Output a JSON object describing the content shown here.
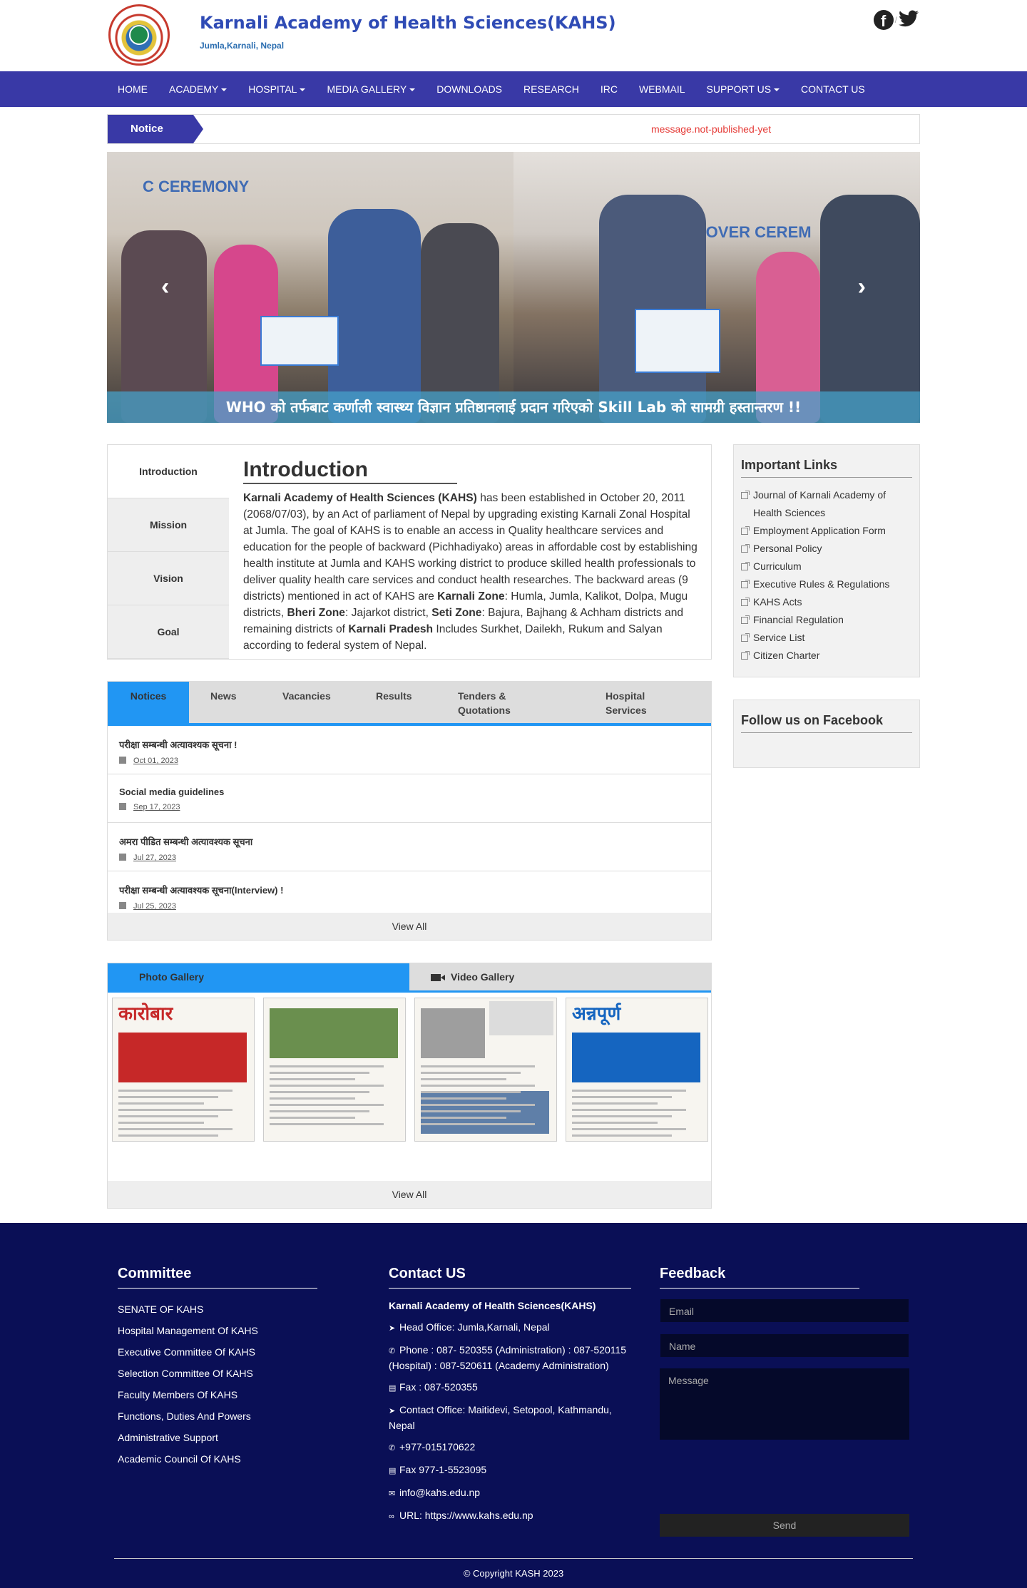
{
  "header": {
    "title": "Karnali Academy of Health Sciences(KAHS)",
    "subtitle": "Jumla,Karnali, Nepal"
  },
  "nav": {
    "items": [
      {
        "label": "HOME",
        "dropdown": false
      },
      {
        "label": "ACADEMY",
        "dropdown": true
      },
      {
        "label": "HOSPITAL",
        "dropdown": true
      },
      {
        "label": "MEDIA GALLERY",
        "dropdown": true
      },
      {
        "label": "DOWNLOADS",
        "dropdown": false
      },
      {
        "label": "RESEARCH",
        "dropdown": false
      },
      {
        "label": "IRC",
        "dropdown": false
      },
      {
        "label": "WEBMAIL",
        "dropdown": false
      },
      {
        "label": "SUPPORT US",
        "dropdown": true
      },
      {
        "label": "CONTACT US",
        "dropdown": false
      }
    ]
  },
  "notice_bar": {
    "label": "Notice",
    "message": "message.not-published-yet"
  },
  "carousel": {
    "caption": "WHO को तर्फबाट कर्णाली स्वास्थ्य विज्ञान प्रतिष्ठानलाई प्रदान गरिएको Skill Lab को सामग्री हस्तान्तरण !!",
    "photo_left_text": "C CEREMONY",
    "photo_right_text": "HAND OVER CEREM"
  },
  "intro": {
    "tabs": [
      "Introduction",
      "Mission",
      "Vision",
      "Goal"
    ],
    "heading": "Introduction"
  },
  "tabs_panel": {
    "tabs": [
      "Notices",
      "News",
      "Vacancies",
      "Results",
      "Tenders & Quotations",
      "Hospital Services"
    ],
    "notices": [
      {
        "title": "परीक्षा सम्बन्धी अत्यावश्यक सूचना !",
        "date": "Oct 01, 2023"
      },
      {
        "title": "Social media guidelines",
        "date": "Sep 17, 2023"
      },
      {
        "title": "अमरा पीडित सम्बन्धी अत्यावश्यक सूचना",
        "date": "Jul 27, 2023"
      },
      {
        "title": "परीक्षा सम्बन्धी अत्यावश्यक सूचना(Interview) !",
        "date": "Jul 25, 2023"
      }
    ],
    "view_all": "View All"
  },
  "gallery": {
    "photo_tab": "Photo Gallery",
    "video_tab": "Video Gallery",
    "view_all": "View All",
    "thumbs": [
      {
        "masthead": "कारोबार",
        "color": "#c62828"
      },
      {
        "masthead": "",
        "color": "#6a8f4e"
      },
      {
        "masthead": "",
        "color": "#9e9e9e"
      },
      {
        "masthead": "अन्नपूर्ण",
        "color": "#1565c0"
      }
    ]
  },
  "sidebar": {
    "important_title": "Important Links",
    "links": [
      "Journal of Karnali Academy of Health Sciences",
      "Employment Application Form",
      "Personal Policy",
      "Curriculum",
      "Executive Rules & Regulations",
      "KAHS Acts",
      "Financial Regulation",
      "Service List",
      "Citizen Charter"
    ],
    "facebook_title": "Follow us on Facebook"
  },
  "footer": {
    "committee_title": "Committee",
    "committee": [
      "SENATE OF KAHS",
      "Hospital Management Of KAHS",
      "Executive Committee Of KAHS",
      "Selection Committee Of KAHS",
      "Faculty Members Of KAHS",
      "Functions, Duties And Powers",
      "Administrative Support",
      "Academic Council Of KAHS"
    ],
    "contact_title": "Contact US",
    "contact_org": "Karnali Academy of Health Sciences(KAHS)",
    "contacts": [
      {
        "icon": "location-icon",
        "text": "Head Office: Jumla,Karnali, Nepal"
      },
      {
        "icon": "phone-icon",
        "text": "Phone : 087- 520355 (Administration) : 087-520115 (Hospital) : 087-520611 (Academy Administration)"
      },
      {
        "icon": "fax-icon",
        "text": "Fax : 087-520355"
      },
      {
        "icon": "location-icon",
        "text": "Contact Office: Maitidevi, Setopool, Kathmandu, Nepal"
      },
      {
        "icon": "phone-icon",
        "text": "+977-015170622"
      },
      {
        "icon": "fax-icon",
        "text": "Fax 977-1-5523095"
      },
      {
        "icon": "mail-icon",
        "text": "info@kahs.edu.np"
      },
      {
        "icon": "link-icon",
        "text": "URL: https://www.kahs.edu.np"
      }
    ],
    "feedback_title": "Feedback",
    "email_placeholder": "Email",
    "name_placeholder": "Name",
    "message_placeholder": "Message",
    "send_label": "Send",
    "copyright": "© Copyright KASH 2023"
  },
  "colors": {
    "nav_bg": "#3939a6",
    "title_blue": "#2f4bb5",
    "tab_active": "#2196f3",
    "footer_bg": "#0a0f56",
    "notice_red": "#e53935"
  }
}
